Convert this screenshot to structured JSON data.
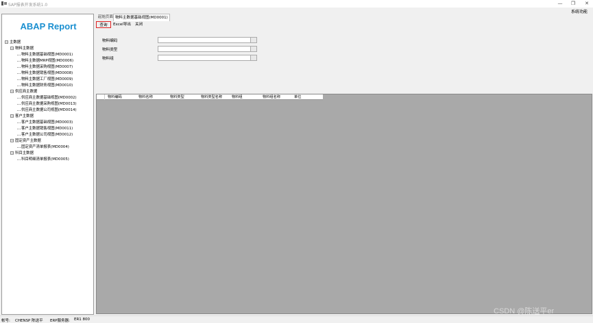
{
  "window": {
    "title": "SAP报表开发系统1.0",
    "minimize": "—",
    "restore": "❐",
    "close": "✕",
    "system_menu": "系统功能"
  },
  "sidebar": {
    "logo": "ABAP Report",
    "tree": [
      {
        "label": "主数据",
        "level": 1,
        "expander": "−"
      },
      {
        "label": "物料主数据",
        "level": 2,
        "expander": "−"
      },
      {
        "label": "物料主数据基础视图(MD0001)",
        "level": 3
      },
      {
        "label": "物料主数据MRP视图(MD0006)",
        "level": 3
      },
      {
        "label": "物料主数据采购视图(MD0007)",
        "level": 3
      },
      {
        "label": "物料主数据销售视图(MD0008)",
        "level": 3
      },
      {
        "label": "物料主数据工厂视图(MD0009)",
        "level": 3
      },
      {
        "label": "物料主数据财务视图(MD0010)",
        "level": 3
      },
      {
        "label": "供应商主数据",
        "level": 2,
        "expander": "−"
      },
      {
        "label": "供应商主数据基础视图(MD0002)",
        "level": 3
      },
      {
        "label": "供应商主数据采购视图(MD0013)",
        "level": 3
      },
      {
        "label": "供应商主数据公司视图(MD0014)",
        "level": 3
      },
      {
        "label": "客户主数据",
        "level": 2,
        "expander": "−"
      },
      {
        "label": "客户主数据基础视图(MD0003)",
        "level": 3
      },
      {
        "label": "客户主数据销售视图(MD0011)",
        "level": 3
      },
      {
        "label": "客户主数据公司视图(MD0012)",
        "level": 3
      },
      {
        "label": "固定资产主数据",
        "level": 2,
        "expander": "−"
      },
      {
        "label": "固定资产清单报表(MD0004)",
        "level": 3
      },
      {
        "label": "科目主数据",
        "level": 2,
        "expander": "−"
      },
      {
        "label": "科目明细清单报表(MD0005)",
        "level": 3
      }
    ]
  },
  "tabs": {
    "start": "起始页面",
    "active": "物料主数据基础视图(MD0001)"
  },
  "toolbar": {
    "query": "查询",
    "excel": "Excel导出",
    "close": "关闭"
  },
  "form": {
    "material_code_label": "物料编码",
    "material_type_label": "物料类型",
    "material_group_label": "物料组",
    "material_code_value": "",
    "material_type_value": "",
    "material_group_value": ""
  },
  "grid": {
    "columns": [
      "物料编码",
      "物料名称",
      "物料类型",
      "物料类型名称",
      "物料组",
      "物料组名称",
      "单位"
    ]
  },
  "status": {
    "account_label": "帐号:",
    "account_value": "CHENSP 陈送平",
    "erp_label": "ERP服务器:",
    "erp_value": "ER1 800"
  },
  "watermark": "CSDN @陈送平er"
}
